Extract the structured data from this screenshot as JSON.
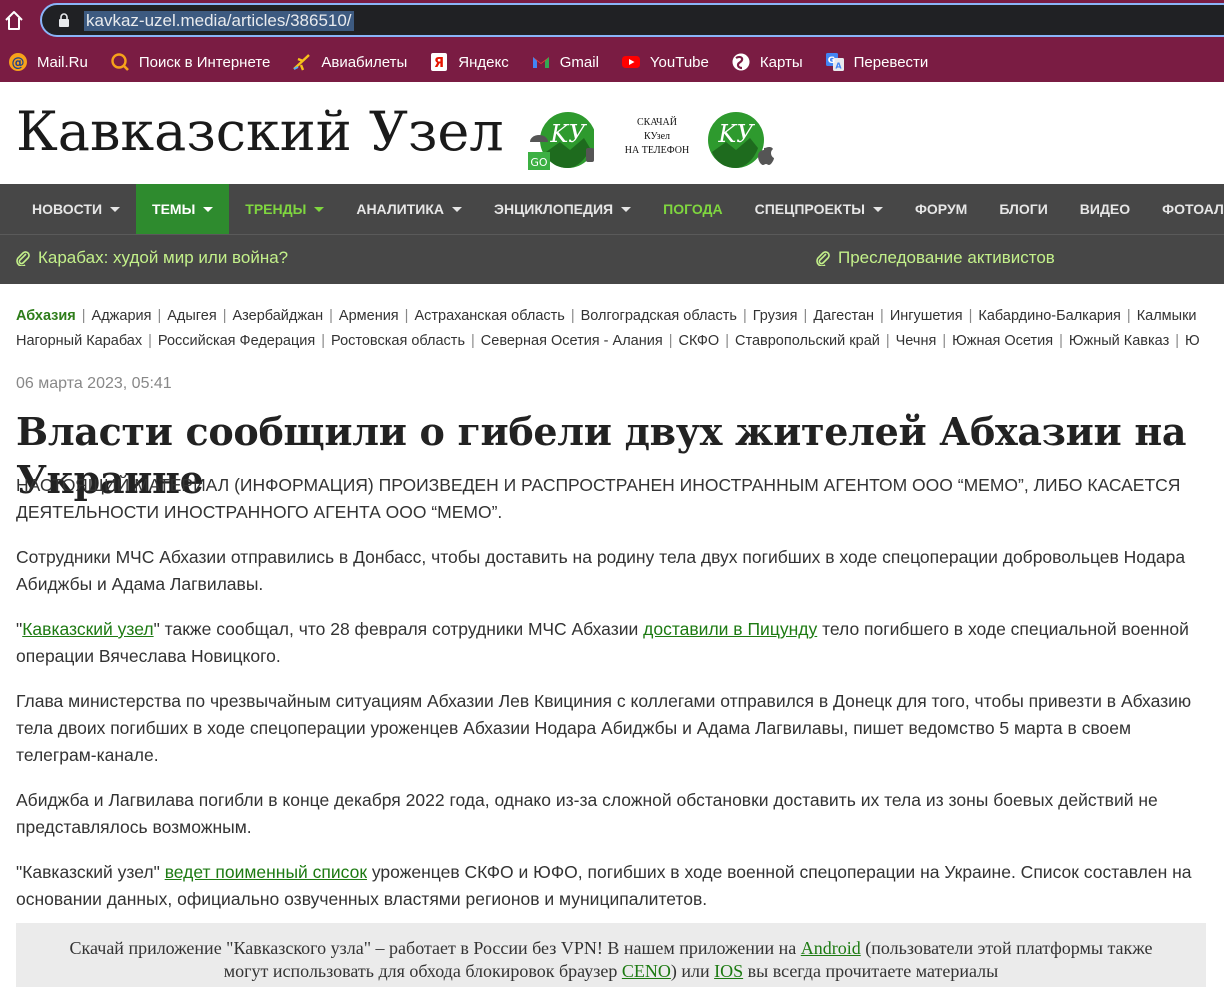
{
  "browser": {
    "url": "kavkaz-uzel.media/articles/386510/",
    "bookmarks": [
      {
        "label": "Mail.Ru",
        "icon": "at-icon"
      },
      {
        "label": "Поиск в Интернете",
        "icon": "search-globe-icon"
      },
      {
        "label": "Авиабилеты",
        "icon": "plane-icon"
      },
      {
        "label": "Яндекс",
        "icon": "yandex-icon"
      },
      {
        "label": "Gmail",
        "icon": "gmail-icon"
      },
      {
        "label": "YouTube",
        "icon": "youtube-icon"
      },
      {
        "label": "Карты",
        "icon": "maps-icon"
      },
      {
        "label": "Перевести",
        "icon": "translate-icon"
      }
    ]
  },
  "header": {
    "logo": "Кавказский Узел",
    "app_promo": [
      "СКАЧАЙ",
      "КУзел",
      "НА ТЕЛЕФОН"
    ],
    "badge_label": "GO"
  },
  "nav": {
    "items": [
      {
        "label": "НОВОСТИ",
        "dropdown": true
      },
      {
        "label": "ТЕМЫ",
        "dropdown": true
      },
      {
        "label": "ТРЕНДЫ",
        "dropdown": true
      },
      {
        "label": "АНАЛИТИКА",
        "dropdown": true
      },
      {
        "label": "ЭНЦИКЛОПЕДИЯ",
        "dropdown": true
      },
      {
        "label": "ПОГОДА",
        "dropdown": false
      },
      {
        "label": "СПЕЦПРОЕКТЫ",
        "dropdown": true
      },
      {
        "label": "ФОРУМ",
        "dropdown": false
      },
      {
        "label": "БЛОГИ",
        "dropdown": false
      },
      {
        "label": "ВИДЕО",
        "dropdown": false
      },
      {
        "label": "ФОТОАЛЬБ",
        "dropdown": false
      }
    ],
    "sub_links": [
      "Карабах: худой мир или война?",
      "Преследование активистов"
    ]
  },
  "regions": {
    "row1": [
      "Абхазия",
      "Аджария",
      "Адыгея",
      "Азербайджан",
      "Армения",
      "Астраханская область",
      "Волгоградская область",
      "Грузия",
      "Дагестан",
      "Ингушетия",
      "Кабардино-Балкария",
      "Калмыки"
    ],
    "row2": [
      "Нагорный Карабах",
      "Российская Федерация",
      "Ростовская область",
      "Северная Осетия - Алания",
      "СКФО",
      "Ставропольский край",
      "Чечня",
      "Южная Осетия",
      "Южный Кавказ",
      "Ю"
    ]
  },
  "article": {
    "date": "06 марта 2023, 05:41",
    "title": "Власти сообщили о гибели двух жителей Абхазии на Украине",
    "disclaimer": "НАСТОЯЩИЙ МАТЕРИАЛ (ИНФОРМАЦИЯ) ПРОИЗВЕДЕН И РАСПРОСТРАНЕН ИНОСТРАННЫМ АГЕНТОМ ООО “МЕМО”, ЛИБО КАСАЕТСЯ ДЕЯТЕЛЬНОСТИ ИНОСТРАННОГО АГЕНТА ООО “МЕМО”.",
    "p1": "Сотрудники МЧС Абхазии отправились в Донбасс, чтобы доставить на родину тела двух погибших в ходе спецоперации добровольцев Нодара Абиджбы и Адама Лагвилавы.",
    "p2": {
      "q_open": "\"",
      "link1": "Кавказский узел",
      "t1": "\" также сообщал, что 28 февраля сотрудники МЧС Абхазии ",
      "link2": "доставили в Пицунду",
      "t2": " тело погибшего в ходе специальной военной операции Вячеслава Новицкого."
    },
    "p3": "Глава министерства по чрезвычайным ситуациям Абхазии Лев Квициния с коллегами отправился в Донецк для того, чтобы привезти в Абхазию тела двоих погибших в ходе спецоперации уроженцев Абхазии Нодара Абиджбы и Адама Лагвилавы, пишет ведомство 5 марта в своем телеграм-канале.",
    "p4": "Абиджба и Лагвилава погибли в конце декабря 2022 года, однако из-за сложной обстановки доставить их тела из зоны боевых действий не представлялось возможным.",
    "p5": {
      "t0": "\"Кавказский узел\" ",
      "link": "ведет поименный список",
      "t1": " уроженцев СКФО и ЮФО, погибших в ходе военной спецоперации на Украине. Список составлен на основании данных, официально озвученных властями регионов и муниципалитетов."
    }
  },
  "promo": {
    "t0": "Скачай приложение \"Кавказского узла\" – работает в России без VPN! В нашем приложении на ",
    "link_android": "Android",
    "t1": " (пользователи этой платформы также могут использовать для обхода блокировок браузер ",
    "link_ceno": "CENO",
    "t2": ") или ",
    "link_ios": "IOS",
    "t3": " вы всегда прочитаете материалы"
  },
  "colors": {
    "chrome": "#7a1c43",
    "nav": "#474747",
    "accent_green": "#2e8b2e",
    "link_green": "#1d7a12",
    "sublink_green": "#c3f08a"
  }
}
